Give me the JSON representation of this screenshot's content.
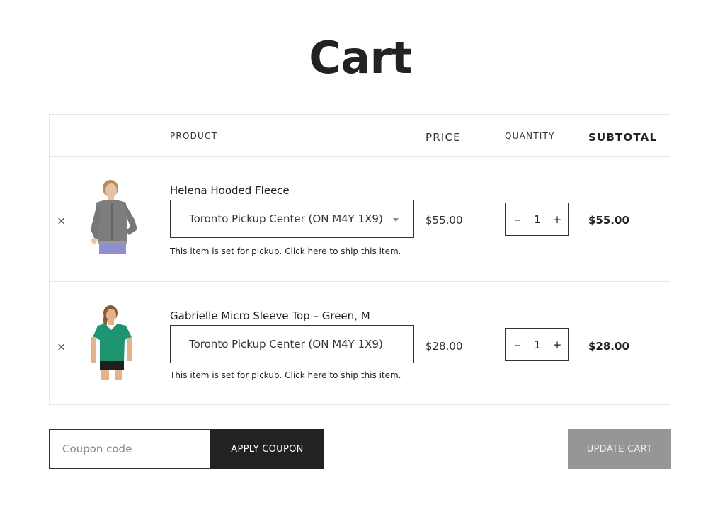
{
  "page": {
    "title": "Cart"
  },
  "table": {
    "headers": {
      "product": "PRODUCT",
      "price": "PRICE",
      "quantity": "QUANTITY",
      "subtotal": "SUBTOTAL"
    }
  },
  "items": [
    {
      "remove_symbol": "×",
      "name": "Helena Hooded Fleece",
      "pickup_location": "Toronto Pickup Center (ON M4Y 1X9)",
      "pickup_has_dropdown": true,
      "pickup_note": "This item is set for pickup. Click here to ship this item.",
      "price": "$55.00",
      "quantity": "1",
      "qty_minus": "–",
      "qty_plus": "+",
      "subtotal": "$55.00",
      "image_icon": "gray-hooded-fleece-photo",
      "image_colors": {
        "garment": "#7d7d7d",
        "pants": "#8f8fcf",
        "skin": "#e6c2a3",
        "hair": "#b68a5a"
      }
    },
    {
      "remove_symbol": "×",
      "name": "Gabrielle Micro Sleeve Top – Green, M",
      "pickup_location": "Toronto Pickup Center (ON M4Y 1X9)",
      "pickup_has_dropdown": false,
      "pickup_note": "This item is set for pickup. Click here to ship this item.",
      "price": "$28.00",
      "quantity": "1",
      "qty_minus": "–",
      "qty_plus": "+",
      "subtotal": "$28.00",
      "image_icon": "green-tshirt-photo",
      "image_colors": {
        "garment": "#1e9471",
        "shorts": "#1f1f1f",
        "skin": "#e3b28f",
        "hair": "#8a5a33"
      }
    }
  ],
  "coupon": {
    "placeholder": "Coupon code",
    "value": "",
    "apply_label": "APPLY COUPON"
  },
  "actions": {
    "update_label": "UPDATE CART"
  },
  "colors": {
    "text": "#222222",
    "border": "#e6e6e6",
    "apply_bg": "#222222",
    "update_bg": "#969696"
  }
}
